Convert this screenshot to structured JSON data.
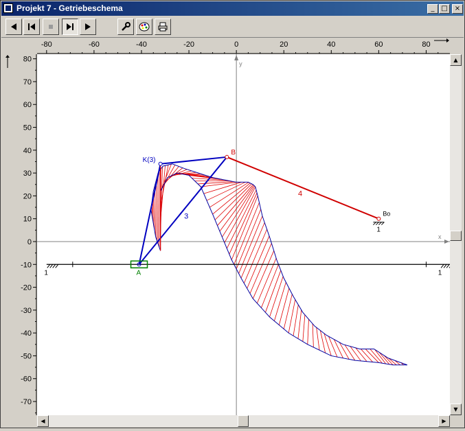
{
  "window": {
    "title": "Projekt 7 - Getriebeschema"
  },
  "caption_buttons": {
    "minimize": "_",
    "maximize": "□",
    "close": "×"
  },
  "toolbar": [
    {
      "name": "play-back-button",
      "glyph": "◀",
      "disabled": false,
      "pressed": false
    },
    {
      "name": "go-to-start-button",
      "glyph": "|◀",
      "disabled": false,
      "pressed": false
    },
    {
      "name": "stop-button",
      "glyph": "■",
      "disabled": true,
      "pressed": false
    },
    {
      "name": "go-to-end-button",
      "glyph": "▶|",
      "disabled": false,
      "pressed": true
    },
    {
      "name": "play-forward-button",
      "glyph": "▶",
      "disabled": false,
      "pressed": false
    },
    {
      "name": "settings-tool-button",
      "glyph": "wrench",
      "disabled": false,
      "pressed": false
    },
    {
      "name": "color-palette-button",
      "glyph": "palette",
      "disabled": false,
      "pressed": false
    },
    {
      "name": "print-button",
      "glyph": "printer",
      "disabled": false,
      "pressed": false
    }
  ],
  "axes": {
    "x_ticks": [
      "-80",
      "-60",
      "-40",
      "-20",
      "0",
      "20",
      "40",
      "60",
      "80"
    ],
    "y_ticks": [
      "80",
      "70",
      "60",
      "50",
      "40",
      "30",
      "20",
      "10",
      "0",
      "-10",
      "-20",
      "-30",
      "-40",
      "-50",
      "-60",
      "-70"
    ],
    "x_label": "x",
    "y_label": "y",
    "xlim": [
      -84,
      90
    ],
    "ylim": [
      -76,
      82
    ]
  },
  "mechanism": {
    "ground_line_y": -10,
    "points": {
      "A": {
        "label": "A",
        "x": -41,
        "y": -10
      },
      "K": {
        "label": "K(3)",
        "x": -32,
        "y": 34
      },
      "B": {
        "label": "B",
        "x": -4,
        "y": 37
      },
      "Bo": {
        "label": "Bo",
        "x": 60,
        "y": 10
      }
    },
    "link_labels": {
      "coupler": "3",
      "rocker": "4"
    },
    "frame_labels": [
      "1",
      "1",
      "1"
    ],
    "colors": {
      "coupler": "#0000c0",
      "rocker": "#d00000",
      "frame": "#000000",
      "joint_A": "#008000",
      "envelope": "#0000a0",
      "hatch": "#e00000",
      "axis": "#808080"
    }
  },
  "envelope": {
    "upper": [
      [
        -36,
        14
      ],
      [
        -35,
        22
      ],
      [
        -33,
        30
      ],
      [
        -31,
        33
      ],
      [
        -27,
        34
      ],
      [
        -22,
        32
      ],
      [
        -16,
        30
      ],
      [
        -10,
        28
      ],
      [
        -5,
        27
      ],
      [
        0,
        26
      ],
      [
        5,
        26
      ],
      [
        7,
        25
      ],
      [
        8,
        24
      ],
      [
        9,
        20
      ],
      [
        11,
        11
      ],
      [
        14,
        2
      ],
      [
        17,
        -8
      ],
      [
        20,
        -16
      ],
      [
        24,
        -24
      ],
      [
        28,
        -31
      ],
      [
        33,
        -37
      ],
      [
        38,
        -41
      ],
      [
        45,
        -45
      ],
      [
        52,
        -47
      ],
      [
        58,
        -47
      ],
      [
        64,
        -51
      ],
      [
        72,
        -54
      ]
    ],
    "lower": [
      [
        -36,
        14
      ],
      [
        -34,
        2
      ],
      [
        -32,
        -4
      ],
      [
        -32,
        22
      ],
      [
        -29,
        28
      ],
      [
        -25,
        30
      ],
      [
        -20,
        29
      ],
      [
        -15,
        24
      ],
      [
        -10,
        12
      ],
      [
        -6,
        2
      ],
      [
        -2,
        -8
      ],
      [
        2,
        -16
      ],
      [
        7,
        -25
      ],
      [
        14,
        -33
      ],
      [
        22,
        -40
      ],
      [
        30,
        -45
      ],
      [
        40,
        -50
      ],
      [
        50,
        -52
      ],
      [
        60,
        -53
      ],
      [
        66,
        -54
      ],
      [
        72,
        -54
      ]
    ]
  }
}
